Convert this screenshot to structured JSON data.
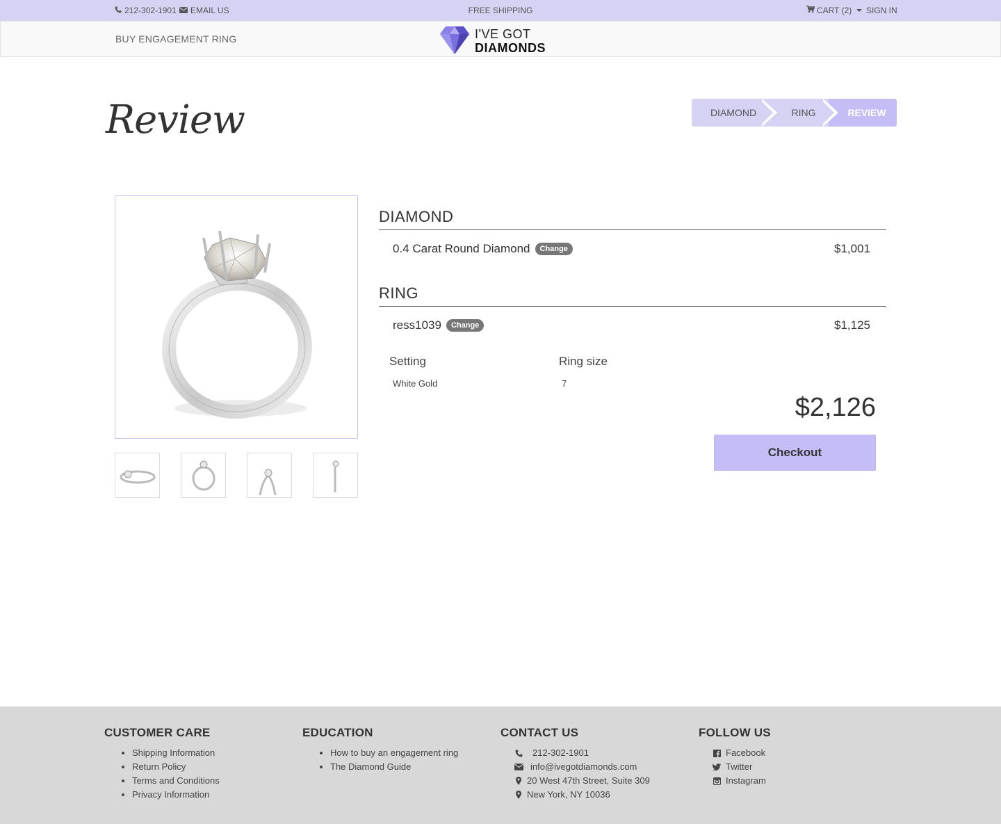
{
  "topbar": {
    "phone": "212-302-1901",
    "email": "EMAIL US",
    "shipping": "FREE SHIPPING",
    "cart": "CART (2)",
    "signin": "SIGN IN"
  },
  "nav": {
    "buy_link": "BUY ENGAGEMENT RING",
    "logo_line1": "I'VE GOT",
    "logo_line2": "DIAMONDS"
  },
  "page": {
    "title": "Review"
  },
  "stepper": {
    "steps": [
      {
        "label": "DIAMOND"
      },
      {
        "label": "RING"
      },
      {
        "label": "REVIEW"
      }
    ],
    "active_index": 2
  },
  "diamond": {
    "heading": "DIAMOND",
    "name": "0.4 Carat Round Diamond",
    "change": "Change",
    "price": "$1,001"
  },
  "ring": {
    "heading": "RING",
    "name": "ress1039",
    "change": "Change",
    "price": "$1,125",
    "setting_label": "Setting",
    "setting_value": "White Gold",
    "size_label": "Ring size",
    "size_value": "7"
  },
  "summary": {
    "total": "$2,126",
    "checkout": "Checkout"
  },
  "footer": {
    "customer_care": {
      "title": "CUSTOMER CARE",
      "links": [
        "Shipping Information",
        "Return Policy",
        "Terms and Conditions",
        "Privacy Information"
      ]
    },
    "education": {
      "title": "EDUCATION",
      "links": [
        "How to buy an engagement ring",
        "The Diamond Guide"
      ]
    },
    "contact": {
      "title": "CONTACT US",
      "phone": "212-302-1901",
      "email": "info@ivegotdiamonds.com",
      "address1": "20 West 47th Street, Suite 309",
      "address2": "New York, NY 10036"
    },
    "follow": {
      "title": "FOLLOW US",
      "facebook": "Facebook",
      "twitter": "Twitter",
      "instagram": "Instagram"
    }
  },
  "colors": {
    "lavender": "#d6d2f4",
    "accent": "#c5bdf6",
    "footer_bg": "#d8d8d8"
  }
}
